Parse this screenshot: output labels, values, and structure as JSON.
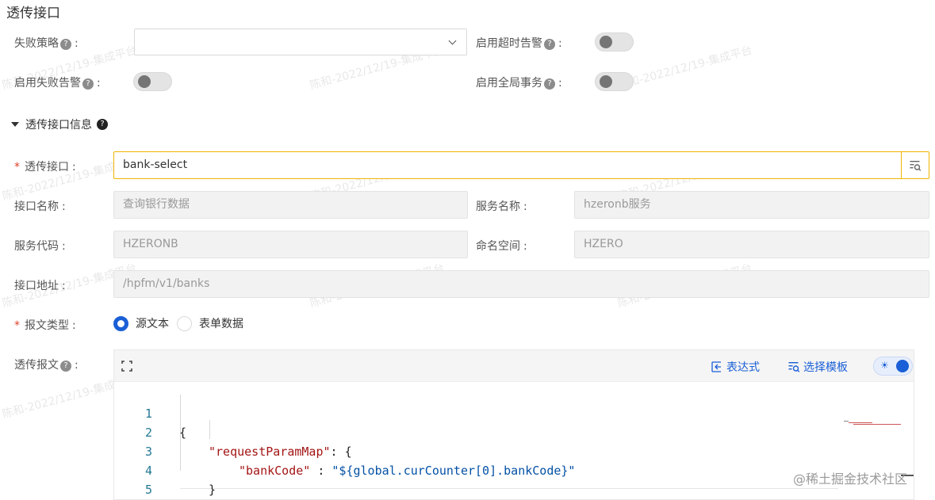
{
  "section_title": "透传接口",
  "watermark": "陈和-2022/12/19-集成平台",
  "failure_policy": {
    "label": "失败策略",
    "value": ""
  },
  "timeout_alarm": {
    "label": "启用超时告警",
    "enabled": false
  },
  "failure_alarm": {
    "label": "启用失败告警",
    "enabled": false
  },
  "global_tx": {
    "label": "启用全局事务",
    "enabled": false
  },
  "group": {
    "title": "透传接口信息"
  },
  "interface": {
    "label": "透传接口",
    "value": "bank-select"
  },
  "interface_name": {
    "label": "接口名称",
    "value": "查询银行数据"
  },
  "service_name": {
    "label": "服务名称",
    "value": "hzeronb服务"
  },
  "service_code": {
    "label": "服务代码",
    "value": "HZERONB"
  },
  "namespace": {
    "label": "命名空间",
    "value": "HZERO"
  },
  "interface_url": {
    "label": "接口地址",
    "value": "/hpfm/v1/banks"
  },
  "message_type": {
    "label": "报文类型",
    "options": [
      "源文本",
      "表单数据"
    ],
    "selected": "源文本"
  },
  "payload": {
    "label": "透传报文",
    "toolbar": {
      "expression": "表达式",
      "template": "选择模板"
    },
    "line_numbers": [
      "1",
      "2",
      "3",
      "4",
      "5"
    ],
    "code": {
      "open_brace": "{",
      "key1": "\"requestParamMap\"",
      "colon1": ": {",
      "key2": "\"bankCode\"",
      "colon2": " : ",
      "val2": "\"${global.curCounter[0].bankCode}\"",
      "close_inner": "}",
      "close_outer": "}"
    }
  },
  "brand": "@稀土掘金技术社区",
  "colors": {
    "accent": "#1a5fd6",
    "active_border": "#f0b400",
    "required": "#e2412b"
  }
}
